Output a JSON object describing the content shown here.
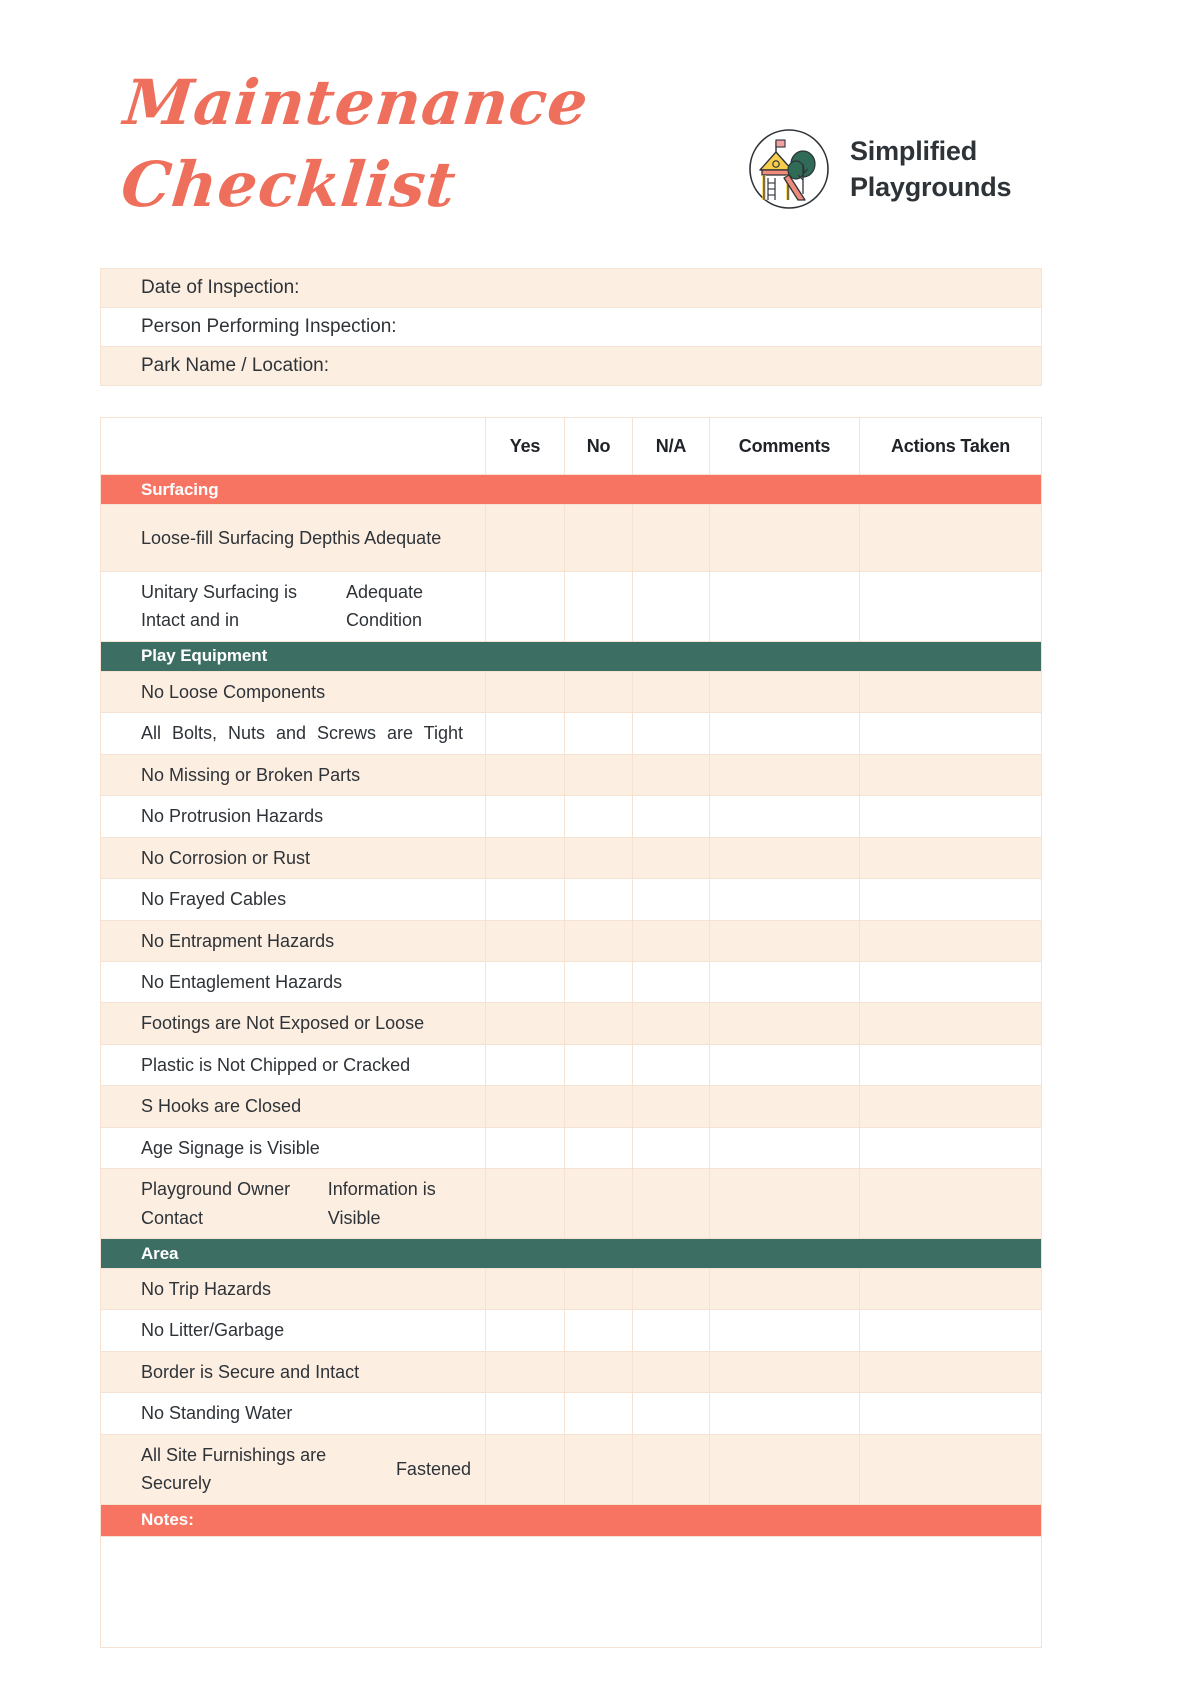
{
  "title": {
    "line1": "Maintenance",
    "line2": "Checklist"
  },
  "brand": {
    "name_line1": "Simplified",
    "name_line2": "Playgrounds",
    "logo_icon": "playground-logo-icon"
  },
  "colors": {
    "title_coral": "#EE6F5B",
    "section_coral": "#F87462",
    "section_green": "#3D6E63",
    "row_tint": "#FDEEE2",
    "border": "#F6E2D2",
    "text": "#2E3338"
  },
  "info_fields": [
    {
      "label": "Date of Inspection:",
      "value": "",
      "shade": "tint"
    },
    {
      "label": "Person Performing Inspection:",
      "value": "",
      "shade": "plain"
    },
    {
      "label": "Park Name / Location:",
      "value": "",
      "shade": "tint"
    }
  ],
  "table": {
    "columns": [
      {
        "key": "item",
        "label": ""
      },
      {
        "key": "yes",
        "label": "Yes"
      },
      {
        "key": "no",
        "label": "No"
      },
      {
        "key": "na",
        "label": "N/A"
      },
      {
        "key": "comments",
        "label": "Comments"
      },
      {
        "key": "actions",
        "label": "Actions Taken"
      }
    ],
    "sections": [
      {
        "name": "Surfacing",
        "color": "coral",
        "rows": [
          {
            "label": "Loose-fill Surfacing Depth",
            "label2": "is Adequate",
            "shade": "tint",
            "tall": true,
            "justify": false
          },
          {
            "label": "Unitary Surfacing is Intact and in",
            "label2": "Adequate Condition",
            "shade": "plain",
            "tall": true,
            "justify": false
          }
        ]
      },
      {
        "name": "Play Equipment",
        "color": "green",
        "rows": [
          {
            "label": "No Loose Components",
            "label2": "",
            "shade": "tint",
            "tall": false,
            "justify": false
          },
          {
            "label": "All Bolts, Nuts and Screws are Tight",
            "label2": "",
            "shade": "plain",
            "tall": false,
            "justify": true
          },
          {
            "label": "No Missing or Broken Parts",
            "label2": "",
            "shade": "tint",
            "tall": false,
            "justify": false
          },
          {
            "label": "No Protrusion Hazards",
            "label2": "",
            "shade": "plain",
            "tall": false,
            "justify": false
          },
          {
            "label": "No Corrosion or Rust",
            "label2": "",
            "shade": "tint",
            "tall": false,
            "justify": false
          },
          {
            "label": "No Frayed Cables",
            "label2": "",
            "shade": "plain",
            "tall": false,
            "justify": false
          },
          {
            "label": "No Entrapment Hazards",
            "label2": "",
            "shade": "tint",
            "tall": false,
            "justify": false
          },
          {
            "label": "No Entaglement Hazards",
            "label2": "",
            "shade": "plain",
            "tall": false,
            "justify": false
          },
          {
            "label": "Footings are Not Exposed or Loose",
            "label2": "",
            "shade": "tint",
            "tall": false,
            "justify": false
          },
          {
            "label": "Plastic is Not Chipped or Cracked",
            "label2": "",
            "shade": "plain",
            "tall": false,
            "justify": false
          },
          {
            "label": "S Hooks are Closed",
            "label2": "",
            "shade": "tint",
            "tall": false,
            "justify": false
          },
          {
            "label": "Age Signage is Visible",
            "label2": "",
            "shade": "plain",
            "tall": false,
            "justify": false
          },
          {
            "label": "Playground Owner Contact",
            "label2": "Information is Visible",
            "shade": "tint",
            "tall": true,
            "justify": false
          }
        ]
      },
      {
        "name": "Area",
        "color": "green",
        "rows": [
          {
            "label": "No Trip Hazards",
            "label2": "",
            "shade": "tint",
            "tall": false,
            "justify": false
          },
          {
            "label": "No Litter/Garbage",
            "label2": "",
            "shade": "plain",
            "tall": false,
            "justify": false
          },
          {
            "label": "Border is Secure and Intact",
            "label2": "",
            "shade": "tint",
            "tall": false,
            "justify": false
          },
          {
            "label": "No Standing Water",
            "label2": "",
            "shade": "plain",
            "tall": false,
            "justify": false
          },
          {
            "label": "All Site Furnishings are Securely",
            "label2": "Fastened",
            "shade": "tint",
            "tall": true,
            "justify": false
          }
        ]
      }
    ],
    "notes": {
      "label": "Notes:",
      "value": ""
    }
  }
}
